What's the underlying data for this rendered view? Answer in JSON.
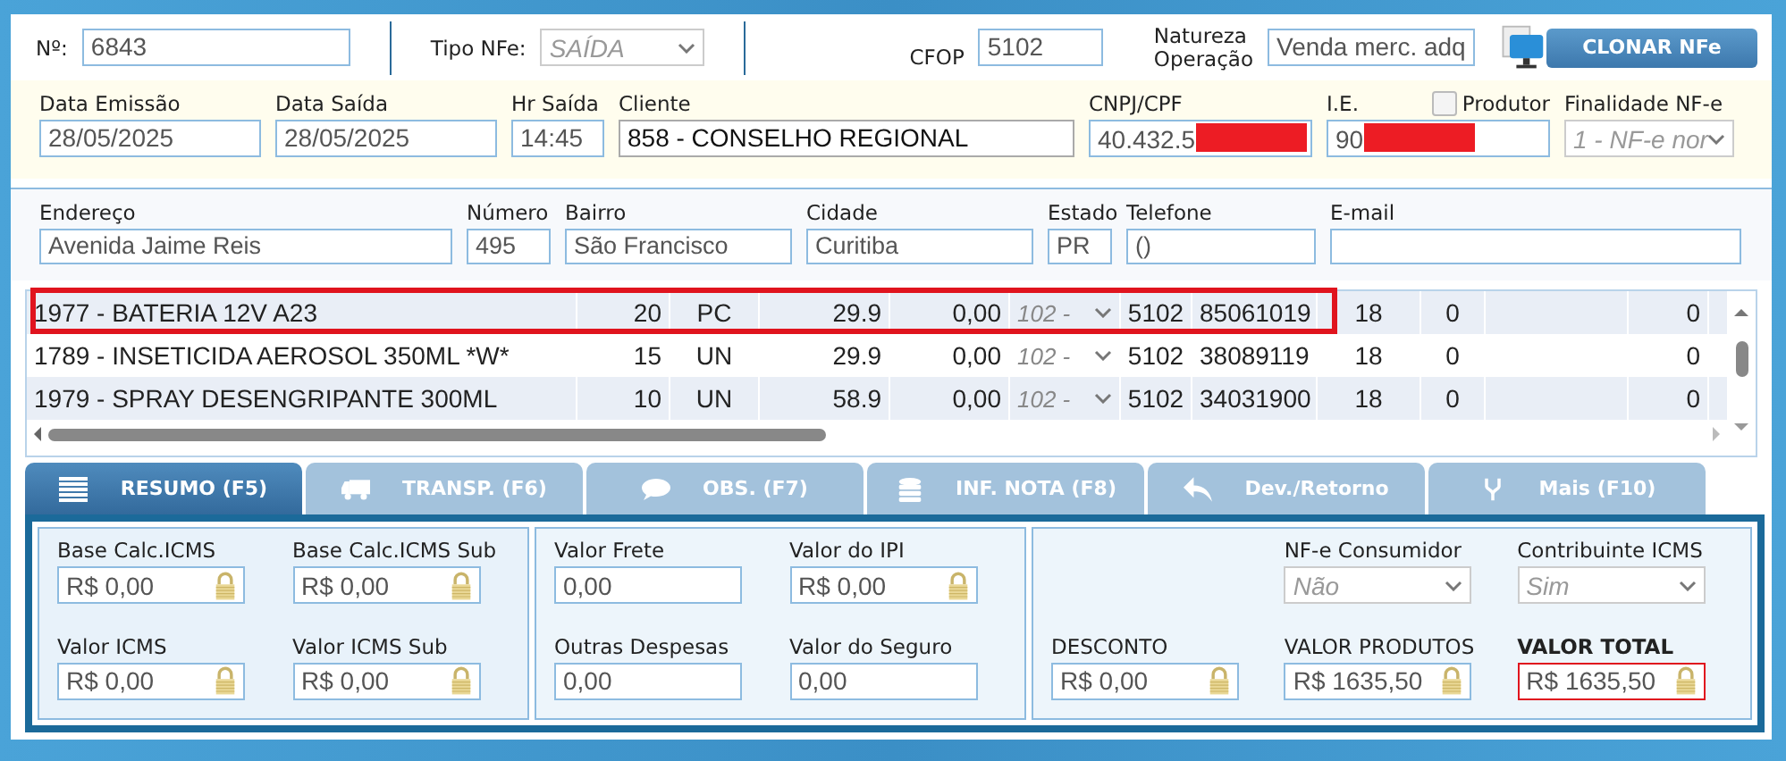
{
  "header": {
    "number": {
      "label": "Nº:",
      "value": "6843"
    },
    "tipo": {
      "label": "Tipo NFe:",
      "value": "SAÍDA",
      "disabled": true
    },
    "cfop": {
      "label": "CFOP",
      "value": "5102"
    },
    "natureza": {
      "label_lines": [
        "Natureza",
        "Operação"
      ],
      "value": "Venda merc. adq"
    },
    "clone_button": "CLONAR NFe"
  },
  "invoice_fields": [
    {
      "kind": "input",
      "label": "Data Emissão",
      "value": "28/05/2025"
    },
    {
      "kind": "input",
      "label": "Data Saída",
      "value": "28/05/2025"
    },
    {
      "kind": "input",
      "label": "Hr Saída",
      "value": "14:45"
    },
    {
      "kind": "lookup",
      "label": "Cliente",
      "value": "858 - CONSELHO REGIONAL"
    },
    {
      "kind": "input",
      "label": "CNPJ/CPF",
      "value": "40.432.5",
      "redacted": true
    },
    {
      "kind": "input",
      "label": "I.E.",
      "value": "90",
      "redacted": true,
      "checkbox": {
        "label": "Produtor",
        "checked": false
      }
    },
    {
      "kind": "select",
      "label": "Finalidade NF-e",
      "value": "1 - NF-e nor",
      "disabled": true
    }
  ],
  "address_fields": [
    {
      "label": "Endereço",
      "value": "Avenida Jaime Reis"
    },
    {
      "label": "Número",
      "value": "495"
    },
    {
      "label": "Bairro",
      "value": "São Francisco"
    },
    {
      "label": "Cidade",
      "value": "Curitiba"
    },
    {
      "label": "Estado",
      "value": "PR"
    },
    {
      "label": "Telefone",
      "value": "()"
    },
    {
      "label": "E-mail"
    }
  ],
  "items": [
    {
      "selected": true,
      "column_1": "1977 - BATERIA 12V A23",
      "column_2": "20",
      "column_3": "PC",
      "column_4": "29.9",
      "column_5": "0,00",
      "column_6": "102 -",
      "column_7": "5102",
      "column_8": "85061019",
      "column_9": "18",
      "column_10": "0",
      "column_12": "0"
    },
    {
      "selected": false,
      "column_1": "1789 - INSETICIDA AEROSOL 350ML *W*",
      "column_2": "15",
      "column_3": "UN",
      "column_4": "29.9",
      "column_5": "0,00",
      "column_6": "102 -",
      "column_7": "5102",
      "column_8": "38089119",
      "column_9": "18",
      "column_10": "0",
      "column_12": "0"
    },
    {
      "selected": false,
      "column_1": "1979 - SPRAY DESENGRIPANTE  300ML",
      "column_2": "10",
      "column_3": "UN",
      "column_4": "58.9",
      "column_5": "0,00",
      "column_6": "102 -",
      "column_7": "5102",
      "column_8": "34031900",
      "column_9": "18",
      "column_10": "0",
      "column_12": "0"
    }
  ],
  "tabs": [
    {
      "label": "RESUMO (F5)",
      "selected": true
    },
    {
      "label": "TRANSP. (F6)",
      "selected": false
    },
    {
      "label": "OBS. (F7)",
      "selected": false
    },
    {
      "label": "INF. NOTA (F8)",
      "selected": false
    },
    {
      "label": "Dev./Retorno",
      "selected": false
    },
    {
      "label": "Mais (F10)",
      "selected": false
    }
  ],
  "summary_groups": [
    {
      "fields": [
        {
          "kind": "locked",
          "label": "Base Calc.ICMS",
          "value": "R$ 0,00"
        },
        {
          "kind": "locked",
          "label": "Base Calc.ICMS Sub",
          "value": "R$ 0,00"
        },
        {
          "kind": "locked",
          "label": "Valor ICMS",
          "value": "R$ 0,00"
        },
        {
          "kind": "locked",
          "label": "Valor ICMS Sub",
          "value": "R$ 0,00"
        }
      ]
    },
    {
      "fields": [
        {
          "kind": "input",
          "label": "Valor Frete",
          "value": "0,00"
        },
        {
          "kind": "locked",
          "label": "Valor do IPI",
          "value": "R$ 0,00"
        },
        {
          "kind": "input",
          "label": "Outras Despesas",
          "value": "0,00"
        },
        {
          "kind": "input",
          "label": "Valor do Seguro",
          "value": "0,00"
        }
      ]
    },
    {
      "fields": [
        {
          "kind": "blank"
        },
        {
          "kind": "select",
          "label": "NF-e Consumidor",
          "value": "Não",
          "disabled": true
        },
        {
          "kind": "select",
          "label": "Contribuinte ICMS",
          "value": "Sim",
          "disabled": true
        },
        {
          "kind": "locked",
          "label": "DESCONTO",
          "value": "R$ 0,00"
        },
        {
          "kind": "locked",
          "label": "VALOR PRODUTOS",
          "value": "R$ 1635,50"
        },
        {
          "kind": "locked",
          "label": "VALOR TOTAL",
          "value": "R$ 1635,50",
          "highlight": true
        }
      ]
    }
  ]
}
